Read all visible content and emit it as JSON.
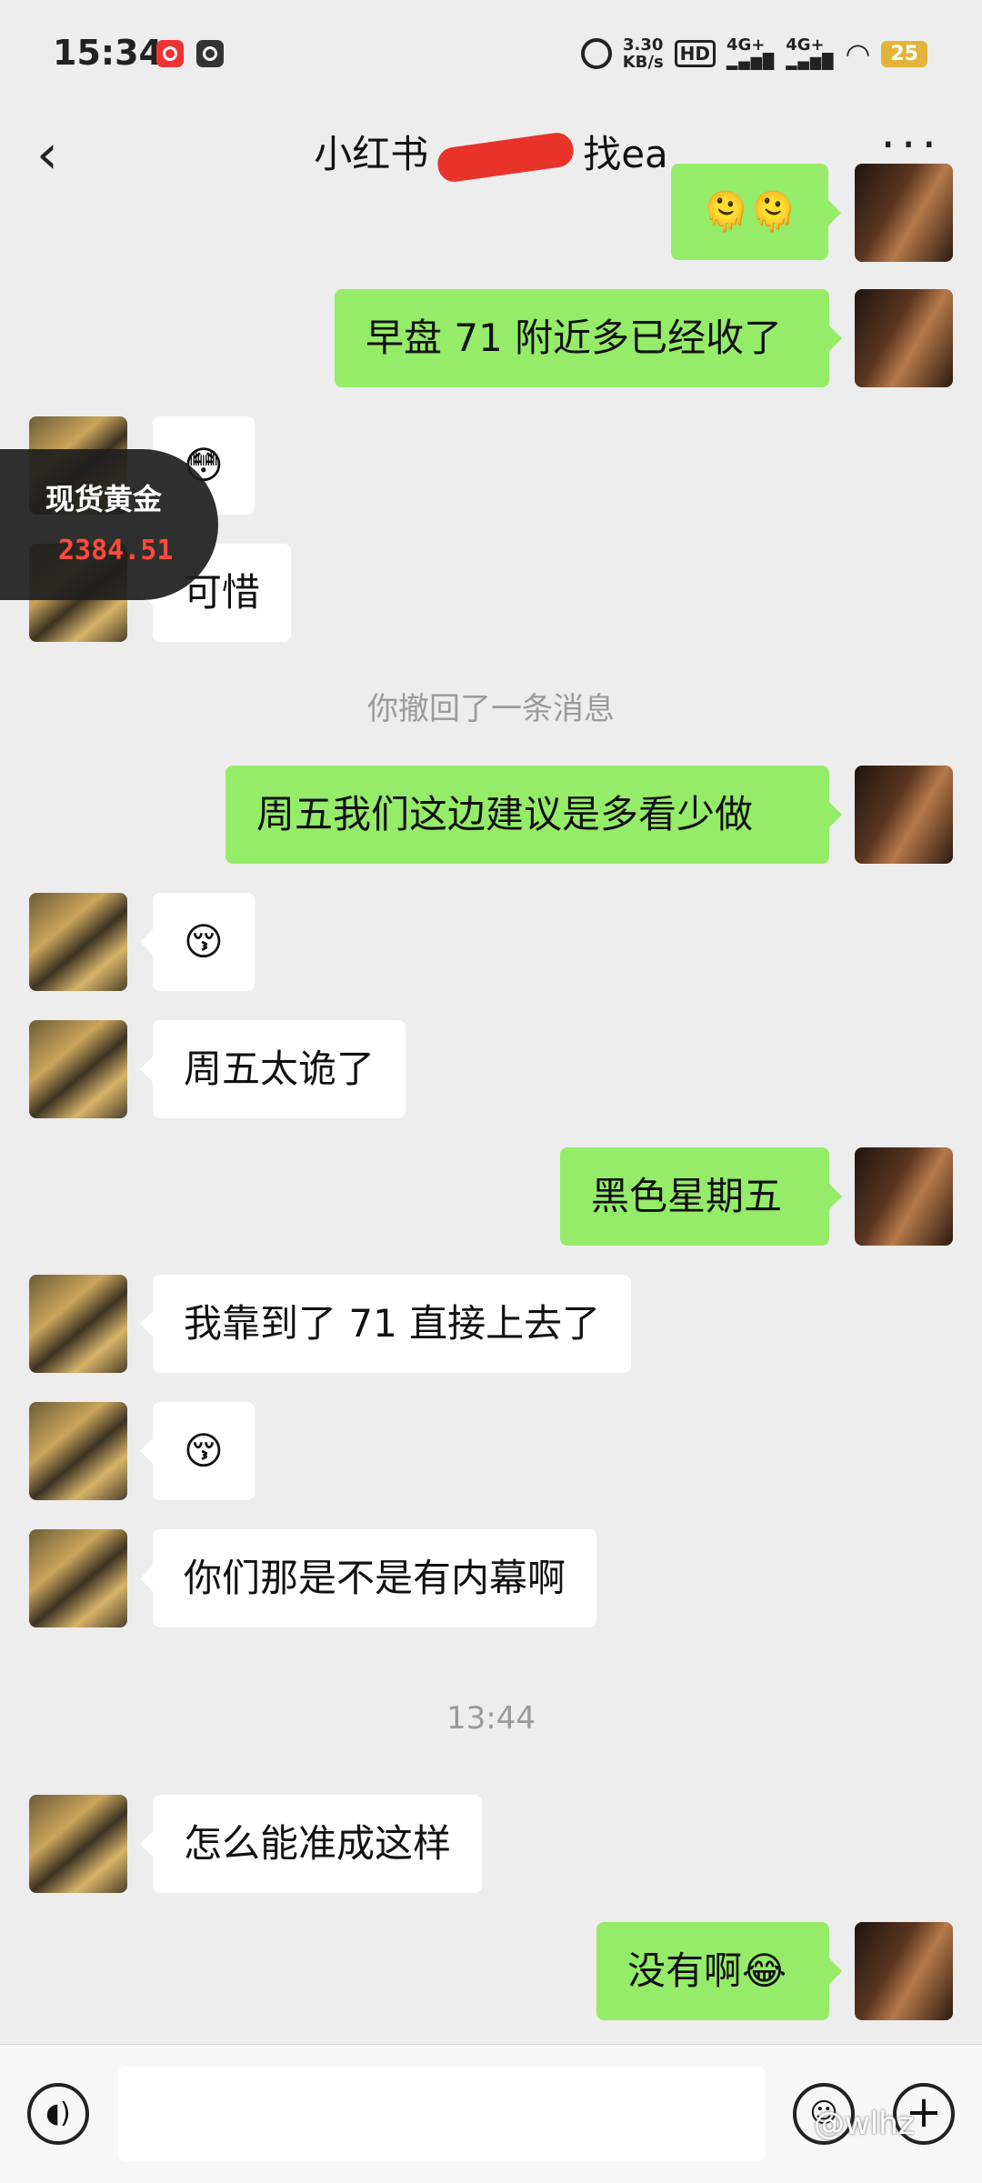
{
  "status_bar": {
    "time": "15:34",
    "speed": "3.30",
    "speed_unit": "KB/s",
    "hd": "HD",
    "net1": "4G+",
    "net2": "4G+",
    "battery": "25"
  },
  "header": {
    "title_left": "小红书",
    "title_right": "找ea",
    "back_icon": "back-chevron-icon",
    "more_icon": "more-dots-icon"
  },
  "gold_widget": {
    "label": "现货黄金",
    "price": "2384.51"
  },
  "messages": [
    {
      "side": "right",
      "text": "🫠🫠"
    },
    {
      "side": "right",
      "text": "早盘 71 附近多已经收了"
    },
    {
      "side": "left",
      "text": "😳"
    },
    {
      "side": "left",
      "text": "可惜"
    },
    {
      "side": "system",
      "text": "你撤回了一条消息"
    },
    {
      "side": "right",
      "text": "周五我们这边建议是多看少做"
    },
    {
      "side": "left",
      "text": "😚"
    },
    {
      "side": "left",
      "text": "周五太诡了"
    },
    {
      "side": "right",
      "text": "黑色星期五"
    },
    {
      "side": "left",
      "text": "我靠到了 71 直接上去了"
    },
    {
      "side": "left",
      "text": "😚"
    },
    {
      "side": "left",
      "text": "你们那是不是有内幕啊"
    },
    {
      "side": "system",
      "text": "13:44"
    },
    {
      "side": "left",
      "text": "怎么能准成这样"
    },
    {
      "side": "right",
      "text": "没有啊😂"
    }
  ],
  "input_bar": {
    "placeholder": "",
    "voice_icon": "voice-icon",
    "emoji_icon": "emoji-icon",
    "plus_icon": "plus-icon"
  },
  "watermark": "@wlhz"
}
